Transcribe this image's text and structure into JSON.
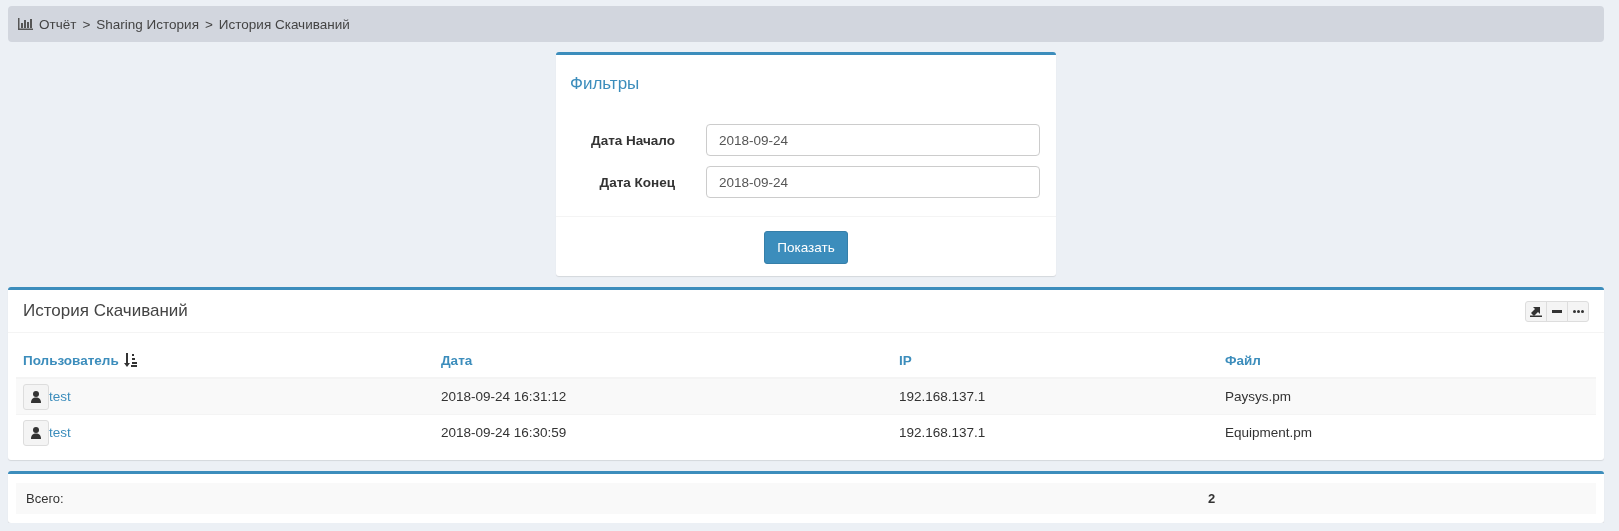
{
  "breadcrumb": {
    "separator": ">",
    "items": [
      {
        "label": "Отчёт"
      },
      {
        "label": "Sharing История"
      },
      {
        "label": "История Скачиваний"
      }
    ]
  },
  "filters": {
    "title": "Фильтры",
    "fields": [
      {
        "label": "Дата Начало",
        "value": "2018-09-24"
      },
      {
        "label": "Дата Конец",
        "value": "2018-09-24"
      }
    ],
    "button": "Показать"
  },
  "history": {
    "title": "История Скачиваний",
    "columns": [
      {
        "label": "Пользователь",
        "sorted": true
      },
      {
        "label": "Дата",
        "sorted": false
      },
      {
        "label": "IP",
        "sorted": false
      },
      {
        "label": "Файл",
        "sorted": false
      }
    ],
    "rows": [
      {
        "user": "test",
        "date": "2018-09-24 16:31:12",
        "ip": "192.168.137.1",
        "file": "Paysys.pm"
      },
      {
        "user": "test",
        "date": "2018-09-24 16:30:59",
        "ip": "192.168.137.1",
        "file": "Equipment.pm"
      }
    ]
  },
  "totals": {
    "label": "Всего:",
    "value": "2"
  }
}
